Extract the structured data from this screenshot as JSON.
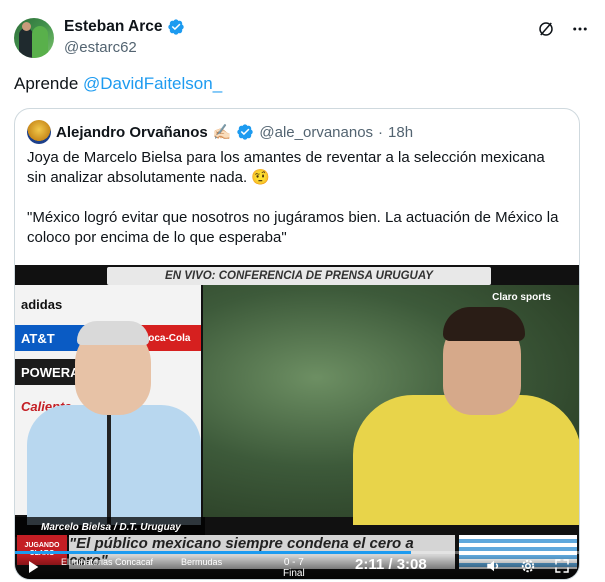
{
  "author": {
    "name": "Esteban Arce",
    "handle": "@estarc62"
  },
  "post": {
    "text_prefix": "Aprende ",
    "mention": "@DavidFaitelson_"
  },
  "quoted": {
    "name": "Alejandro Orvañanos",
    "name_emoji": "✍🏻",
    "handle": "@ale_orvananos",
    "separator": "·",
    "time": "18h",
    "paragraph1": "Joya de Marcelo Bielsa para los amantes de reventar a la selección mexicana sin analizar absolutamente nada. 🤨",
    "paragraph2": "\"México logró evitar que nosotros no jugáramos bien. La actuación de México la coloco por encima de lo que esperaba\""
  },
  "video": {
    "banner_top": "EN VIVO: CONFERENCIA DE PRENSA URUGUAY",
    "name_bar": "Marcelo Bielsa / D.T. Uruguay",
    "quote_bar": "\"El público mexicano siempre condena el cero a cero\"",
    "claro_logo": "Claro sports",
    "jugando": "JUGANDO CLARO",
    "ticker_left": "Eliminatorias Concacaf",
    "ticker_team": "Bermudas",
    "score": "0 - 7",
    "score_status": "Final",
    "time": "2:11 / 3:08",
    "progress": 0.7,
    "sponsors": [
      "adidas",
      "AT&T",
      "Coca-Cola",
      "POWERADE",
      "Caliente"
    ]
  },
  "icons": {
    "verified": "verified-badge-icon",
    "grok": "grok-icon",
    "more": "more-icon",
    "play": "play-icon",
    "volume": "volume-icon",
    "settings": "settings-icon",
    "fullscreen": "fullscreen-icon"
  },
  "colors": {
    "accent": "#1d9bf0",
    "text": "#0f1419",
    "muted": "#536471",
    "border": "#cfd9de"
  }
}
